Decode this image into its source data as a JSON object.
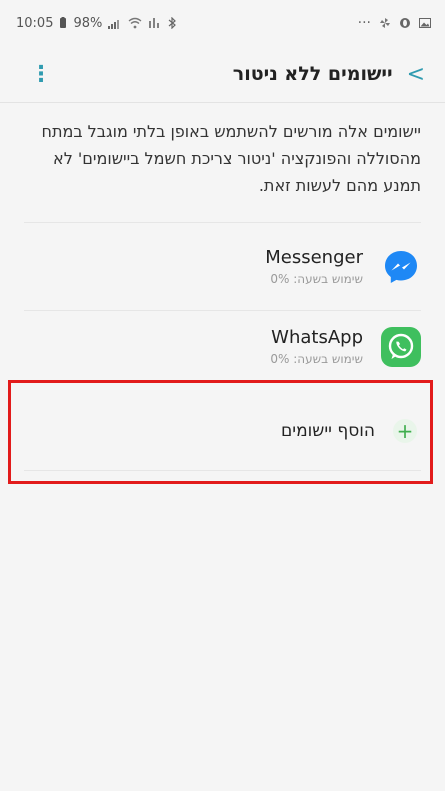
{
  "status_bar": {
    "time": "10:05",
    "battery": "98%",
    "dots": "···"
  },
  "header": {
    "title": "יישומים ללא ניטור",
    "back_glyph": "<",
    "menu_glyph": "⋮"
  },
  "description": "יישומים אלה מורשים להשתמש באופן בלתי מוגבל במתח מהסוללה והפונקציה 'ניטור צריכת חשמל ביישומים' לא תמנע מהם לעשות זאת.",
  "apps": [
    {
      "name": "Messenger",
      "usage": "שימוש בשעה: 0%",
      "icon": "messenger-icon"
    },
    {
      "name": "WhatsApp",
      "usage": "שימוש בשעה: 0%",
      "icon": "whatsapp-icon"
    }
  ],
  "add_apps": {
    "label": "הוסף יישומים",
    "icon": "plus-icon",
    "glyph": "+"
  },
  "colors": {
    "accent": "#2f9bb0",
    "whatsapp": "#3fbf5e",
    "messenger": "#1e88f5",
    "plus": "#3fae4e",
    "highlight": "#e21b1b"
  }
}
